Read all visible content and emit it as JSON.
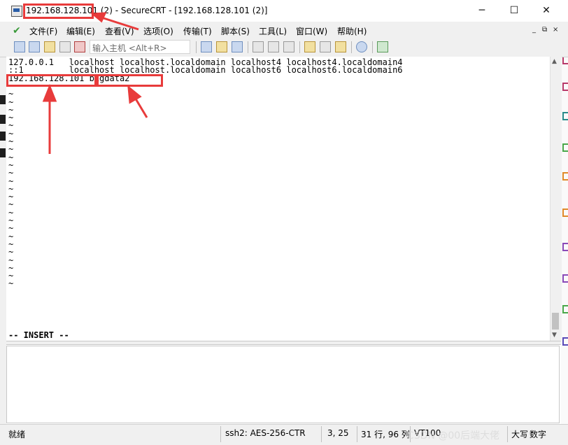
{
  "window": {
    "title_host": "192.168.128.101",
    "title_rest": " (2) - SecureCRT - [192.168.128.101 (2)]",
    "minimize": "─",
    "maximize": "☐",
    "close": "✕"
  },
  "menu": {
    "items": [
      "文件(F)",
      "编辑(E)",
      "查看(V)",
      "选项(O)",
      "传输(T)",
      "脚本(S)",
      "工具(L)",
      "窗口(W)",
      "帮助(H)"
    ],
    "mdi_minimize": "_",
    "mdi_restore": "⧉",
    "mdi_close": "×"
  },
  "toolbar": {
    "quick_connect_placeholder": "输入主机 <Alt+R>"
  },
  "terminal": {
    "lines": [
      "127.0.0.1   localhost localhost.localdomain localhost4 localhost4.localdomain4",
      "::1         localhost localhost.localdomain localhost6 localhost6.localdomain6",
      "192.168.128.101 bigdata2",
      "~",
      "~",
      "~",
      "~",
      "~",
      "~",
      "~",
      "~",
      "~",
      "~",
      "~",
      "~",
      "~",
      "~",
      "~",
      "~",
      "~",
      "~",
      "~",
      "~",
      "~",
      "~",
      "~",
      "~",
      "~",
      "~",
      "-- INSERT --"
    ]
  },
  "status": {
    "ready": "就绪",
    "encryption": "ssh2: AES-256-CTR",
    "cursor": "3, 25",
    "size": "31 行, 96 列",
    "term_type": "VT100",
    "caps": "大写",
    "num": "数字"
  },
  "watermark": "CSDN @00后端大佬",
  "colors": {
    "highlight": "#e83b3b",
    "chrome": "#f0f0f0",
    "terminal_bg": "#ffffff",
    "terminal_fg": "#000000"
  }
}
